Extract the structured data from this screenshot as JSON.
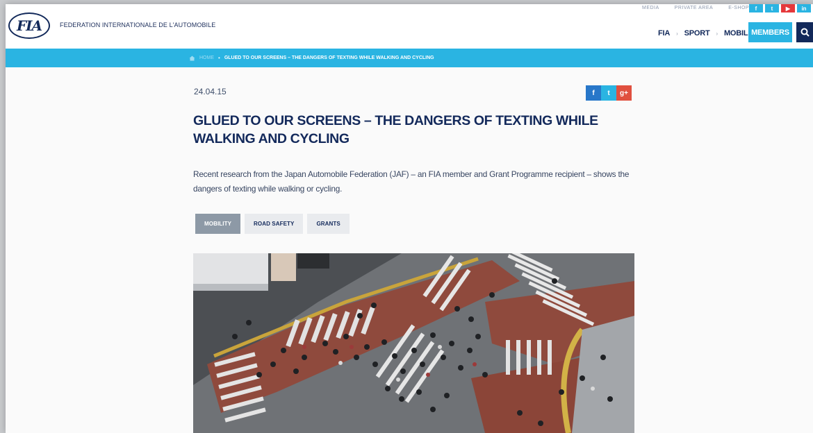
{
  "header": {
    "logo_text": "FIA",
    "org_name": "FEDERATION INTERNATIONALE DE L'AUTOMOBILE",
    "top_links": [
      "MEDIA",
      "PRIVATE AREA",
      "E-SHOP"
    ],
    "top_social": [
      {
        "icon": "facebook-icon",
        "glyph": "f",
        "color": "#2ab4e2"
      },
      {
        "icon": "twitter-icon",
        "glyph": "t",
        "color": "#2ab4e2"
      },
      {
        "icon": "youtube-icon",
        "glyph": "▶",
        "color": "#e5383b"
      },
      {
        "icon": "linkedin-icon",
        "glyph": "in",
        "color": "#2ab4e2"
      }
    ],
    "nav": [
      "FIA",
      "SPORT",
      "MOBILITY"
    ],
    "members_label": "MEMBERS",
    "search_icon": "search-icon"
  },
  "breadcrumb": {
    "home_label": "HOME",
    "current": "GLUED TO OUR SCREENS – THE DANGERS OF TEXTING WHILE WALKING AND CYCLING"
  },
  "article": {
    "date": "24.04.15",
    "share": [
      {
        "icon": "facebook-icon",
        "glyph": "f",
        "color": "#2877c9"
      },
      {
        "icon": "twitter-icon",
        "glyph": "t",
        "color": "#2ab4e2"
      },
      {
        "icon": "google-plus-icon",
        "glyph": "g+",
        "color": "#e0503f"
      }
    ],
    "title": "GLUED TO OUR SCREENS – THE DANGERS OF TEXTING WHILE WALKING AND CYCLING",
    "intro": "Recent research from the Japan Automobile Federation (JAF) – an FIA member and Grant Programme recipient – shows the dangers of texting while walking or cycling.",
    "tags": [
      {
        "label": "MOBILITY",
        "active": true
      },
      {
        "label": "ROAD SAFETY",
        "active": false
      },
      {
        "label": "GRANTS",
        "active": false
      }
    ],
    "hero_image": "aerial-crosswalk-photo"
  },
  "colors": {
    "navy": "#13295b",
    "accent": "#2ab4e2",
    "tag_active": "#8d99a6",
    "tag_bg": "#e9ebee"
  }
}
